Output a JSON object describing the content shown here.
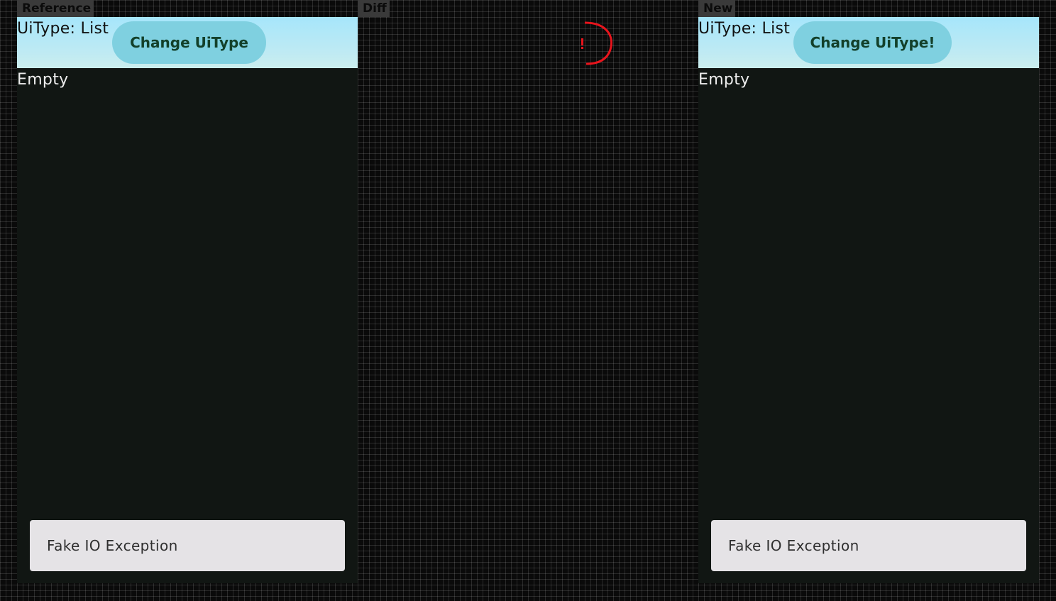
{
  "panels": {
    "reference": {
      "label": "Reference",
      "uitype_text": "UiType: List",
      "button_label": "Change UiType",
      "empty_text": "Empty",
      "snackbar_text": "Fake IO Exception"
    },
    "diff": {
      "label": "Diff"
    },
    "new": {
      "label": "New",
      "uitype_text": "UiType: List",
      "button_label": "Change UiType!",
      "empty_text": "Empty",
      "snackbar_text": "Fake IO Exception"
    }
  },
  "colors": {
    "diff_highlight": "#e8141c",
    "button_bg": "#7fd0e0",
    "topbar_top": "#a6e6fb",
    "screen_bg": "#111613",
    "snackbar_bg": "#e5e3e6"
  }
}
